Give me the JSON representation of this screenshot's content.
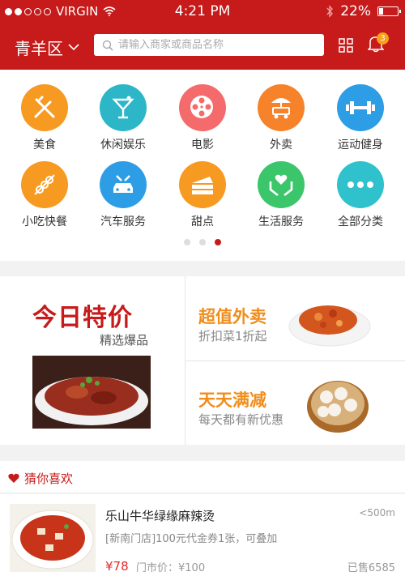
{
  "status_bar": {
    "carrier": "VIRGIN",
    "time": "4:21 PM",
    "battery": "22%",
    "battery_level": 0.22
  },
  "header": {
    "city": "青羊区",
    "search_placeholder": "请输入商家或商品名称",
    "notification_count": "3"
  },
  "categories": [
    {
      "label": "美食",
      "icon": "fork-knife-icon",
      "color": "#f79a21"
    },
    {
      "label": "休闲娱乐",
      "icon": "cocktail-icon",
      "color": "#2cb6c7"
    },
    {
      "label": "电影",
      "icon": "film-reel-icon",
      "color": "#f56a6a"
    },
    {
      "label": "外卖",
      "icon": "delivery-cart-icon",
      "color": "#f6822a"
    },
    {
      "label": "运动健身",
      "icon": "dumbbell-icon",
      "color": "#2d9ee5"
    },
    {
      "label": "小吃快餐",
      "icon": "skewer-icon",
      "color": "#f79a21"
    },
    {
      "label": "汽车服务",
      "icon": "car-icon",
      "color": "#2d9ee5"
    },
    {
      "label": "甜点",
      "icon": "cake-icon",
      "color": "#f79a21"
    },
    {
      "label": "生活服务",
      "icon": "heart-hands-icon",
      "color": "#3cc66b"
    },
    {
      "label": "全部分类",
      "icon": "more-dots-icon",
      "color": "#2fc2cc"
    }
  ],
  "pager": {
    "pages": 3,
    "active": 2
  },
  "promo": {
    "today": {
      "title": "今日特价",
      "subtitle": "精选爆品"
    },
    "takeout": {
      "title": "超值外卖",
      "subtitle": "折扣菜1折起"
    },
    "daily": {
      "title": "天天满减",
      "subtitle": "每天都有新优惠"
    }
  },
  "recommend": {
    "title": "猜你喜欢",
    "item": {
      "name": "乐山牛华绿缘麻辣烫",
      "distance": "<500m",
      "desc": "[新南门店]100元代金券1张，可叠加",
      "price": "¥78",
      "market_price": "门市价：¥100",
      "sold": "已售6585"
    }
  }
}
